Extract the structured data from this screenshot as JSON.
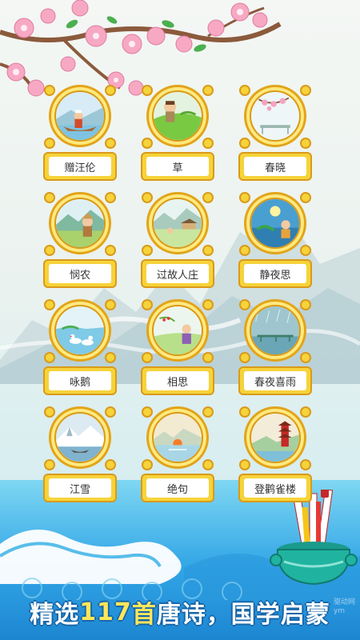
{
  "poems": [
    {
      "title": "赠汪伦",
      "icon": "boat-man-icon"
    },
    {
      "title": "草",
      "icon": "boy-grass-icon"
    },
    {
      "title": "春晓",
      "icon": "peach-blossom-icon"
    },
    {
      "title": "悯农",
      "icon": "farmer-icon"
    },
    {
      "title": "过故人庄",
      "icon": "village-icon"
    },
    {
      "title": "静夜思",
      "icon": "moon-poet-icon"
    },
    {
      "title": "咏鹅",
      "icon": "geese-icon"
    },
    {
      "title": "相思",
      "icon": "red-bean-icon"
    },
    {
      "title": "春夜喜雨",
      "icon": "rain-icon"
    },
    {
      "title": "江雪",
      "icon": "snow-river-icon"
    },
    {
      "title": "绝句",
      "icon": "sunrise-icon"
    },
    {
      "title": "登鹳雀楼",
      "icon": "pagoda-icon"
    }
  ],
  "banner": {
    "part1": "精选",
    "number": "117",
    "part2": "首",
    "part3": "唐诗，国学启蒙"
  },
  "watermark": {
    "line1": "驱动网",
    "line2": "ym"
  },
  "colors": {
    "frame_gold": "#f6d33a",
    "frame_edge": "#d99a1a",
    "highlight": "#ffe65a"
  }
}
